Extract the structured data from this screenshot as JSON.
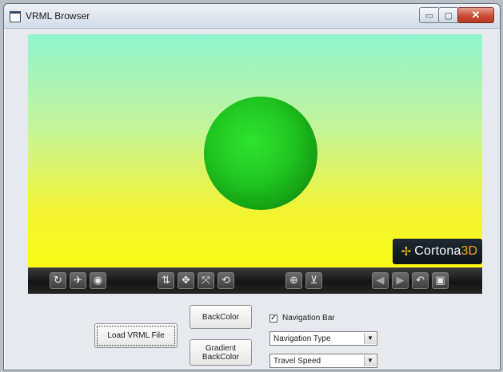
{
  "window": {
    "title": "VRML Browser",
    "controls": {
      "minimize": "▭",
      "maximize": "▢",
      "close": "✕"
    }
  },
  "viewer": {
    "scene": {
      "shape": "sphere",
      "shape_color": "#1fc41f"
    },
    "background_gradient": [
      "#90f4cf",
      "#fafa14"
    ],
    "logo": {
      "mark": "✢",
      "text": "Cortona",
      "suffix": "3D"
    },
    "navbar": {
      "buttons": [
        {
          "name": "walk-icon",
          "glyph": "↻"
        },
        {
          "name": "fly-icon",
          "glyph": "✈"
        },
        {
          "name": "study-icon",
          "glyph": "◉"
        },
        {
          "name": "pan-icon",
          "glyph": "⇅"
        },
        {
          "name": "move-icon",
          "glyph": "✥"
        },
        {
          "name": "turn-icon",
          "glyph": "⤧"
        },
        {
          "name": "roll-icon",
          "glyph": "⟲"
        },
        {
          "name": "goto-icon",
          "glyph": "⊕"
        },
        {
          "name": "align-icon",
          "glyph": "⊻"
        },
        {
          "name": "prev-viewpoint-icon",
          "glyph": "◀"
        },
        {
          "name": "next-viewpoint-icon",
          "glyph": "▶"
        },
        {
          "name": "restore-icon",
          "glyph": "↶"
        },
        {
          "name": "fit-icon",
          "glyph": "▣"
        }
      ]
    }
  },
  "controls": {
    "load_button": "Load VRML File",
    "backcolor_button": "BackColor",
    "gradient_button_line1": "Gradient",
    "gradient_button_line2": "BackColor",
    "navigation_bar_checkbox": {
      "label": "Navigation Bar",
      "checked": true,
      "mark": "✓"
    },
    "navigation_type_select": {
      "value": "Navigation Type",
      "arrow": "▼"
    },
    "travel_speed_select": {
      "value": "Travel Speed",
      "arrow": "▼"
    }
  }
}
